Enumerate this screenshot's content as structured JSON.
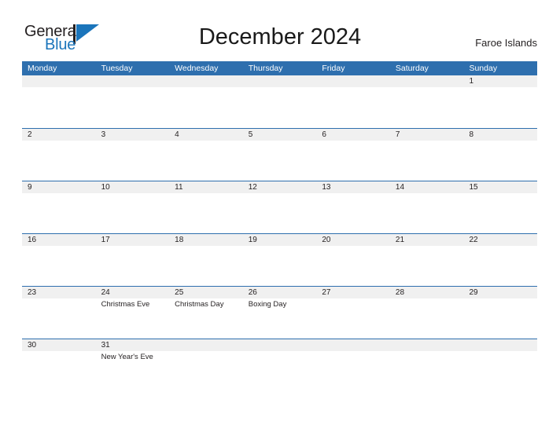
{
  "brand": {
    "name_part_one": "General",
    "name_part_two": "Blue",
    "flag_icon": "blue-triangle-flag-icon",
    "color_dark": "#231f20",
    "color_blue": "#1b75bb"
  },
  "header": {
    "title": "December 2024",
    "location": "Faroe Islands"
  },
  "theme": {
    "header_blue": "#2e6fae",
    "band_gray": "#f0f0f0",
    "rule_blue": "#2e6fae",
    "text_dark": "#231f20"
  },
  "calendar": {
    "weekdays": [
      "Monday",
      "Tuesday",
      "Wednesday",
      "Thursday",
      "Friday",
      "Saturday",
      "Sunday"
    ],
    "weeks": [
      [
        {
          "date": "",
          "events": []
        },
        {
          "date": "",
          "events": []
        },
        {
          "date": "",
          "events": []
        },
        {
          "date": "",
          "events": []
        },
        {
          "date": "",
          "events": []
        },
        {
          "date": "",
          "events": []
        },
        {
          "date": "1",
          "events": []
        }
      ],
      [
        {
          "date": "2",
          "events": []
        },
        {
          "date": "3",
          "events": []
        },
        {
          "date": "4",
          "events": []
        },
        {
          "date": "5",
          "events": []
        },
        {
          "date": "6",
          "events": []
        },
        {
          "date": "7",
          "events": []
        },
        {
          "date": "8",
          "events": []
        }
      ],
      [
        {
          "date": "9",
          "events": []
        },
        {
          "date": "10",
          "events": []
        },
        {
          "date": "11",
          "events": []
        },
        {
          "date": "12",
          "events": []
        },
        {
          "date": "13",
          "events": []
        },
        {
          "date": "14",
          "events": []
        },
        {
          "date": "15",
          "events": []
        }
      ],
      [
        {
          "date": "16",
          "events": []
        },
        {
          "date": "17",
          "events": []
        },
        {
          "date": "18",
          "events": []
        },
        {
          "date": "19",
          "events": []
        },
        {
          "date": "20",
          "events": []
        },
        {
          "date": "21",
          "events": []
        },
        {
          "date": "22",
          "events": []
        }
      ],
      [
        {
          "date": "23",
          "events": []
        },
        {
          "date": "24",
          "events": [
            "Christmas Eve"
          ]
        },
        {
          "date": "25",
          "events": [
            "Christmas Day"
          ]
        },
        {
          "date": "26",
          "events": [
            "Boxing Day"
          ]
        },
        {
          "date": "27",
          "events": []
        },
        {
          "date": "28",
          "events": []
        },
        {
          "date": "29",
          "events": []
        }
      ],
      [
        {
          "date": "30",
          "events": []
        },
        {
          "date": "31",
          "events": [
            "New Year's Eve"
          ]
        },
        {
          "date": "",
          "events": []
        },
        {
          "date": "",
          "events": []
        },
        {
          "date": "",
          "events": []
        },
        {
          "date": "",
          "events": []
        },
        {
          "date": "",
          "events": []
        }
      ]
    ]
  }
}
